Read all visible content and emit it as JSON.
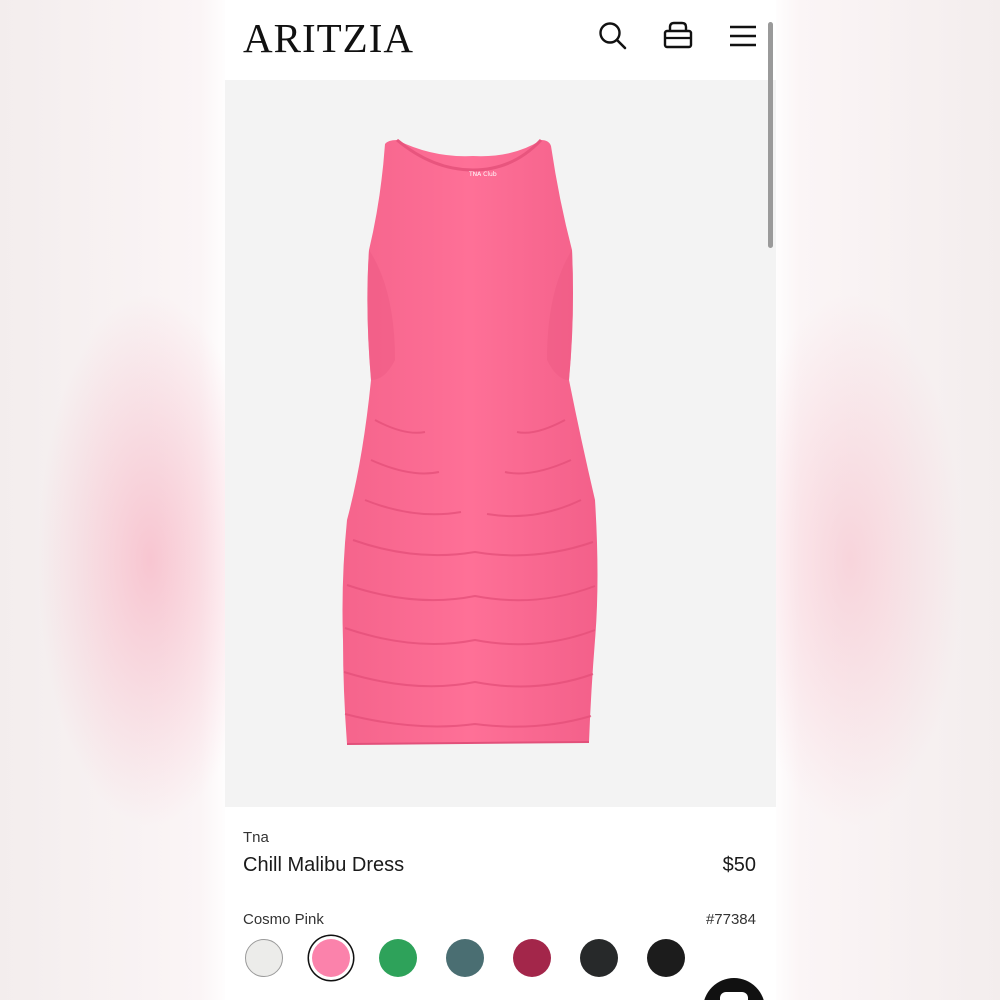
{
  "header": {
    "logo": "ARITZIA",
    "icons": [
      "search-icon",
      "bag-icon",
      "menu-icon"
    ]
  },
  "product": {
    "brand": "Tna",
    "name": "Chill Malibu Dress",
    "price": "$50",
    "selected_color": "Cosmo Pink",
    "sku": "#77384",
    "garment_label": "TNA Club"
  },
  "swatches": [
    {
      "name": "white",
      "color": "#ececea",
      "selected": false
    },
    {
      "name": "cosmo-pink",
      "color": "#fb82ab",
      "selected": true
    },
    {
      "name": "green",
      "color": "#2ea25a",
      "selected": false
    },
    {
      "name": "teal",
      "color": "#4a6e72",
      "selected": false
    },
    {
      "name": "berry",
      "color": "#a3264a",
      "selected": false
    },
    {
      "name": "charcoal",
      "color": "#27292a",
      "selected": false
    },
    {
      "name": "black",
      "color": "#1c1c1c",
      "selected": false
    }
  ],
  "colors": {
    "dress": "#fe6e94",
    "dress_shadow": "#e9517c",
    "image_background": "#f3f3f3"
  }
}
